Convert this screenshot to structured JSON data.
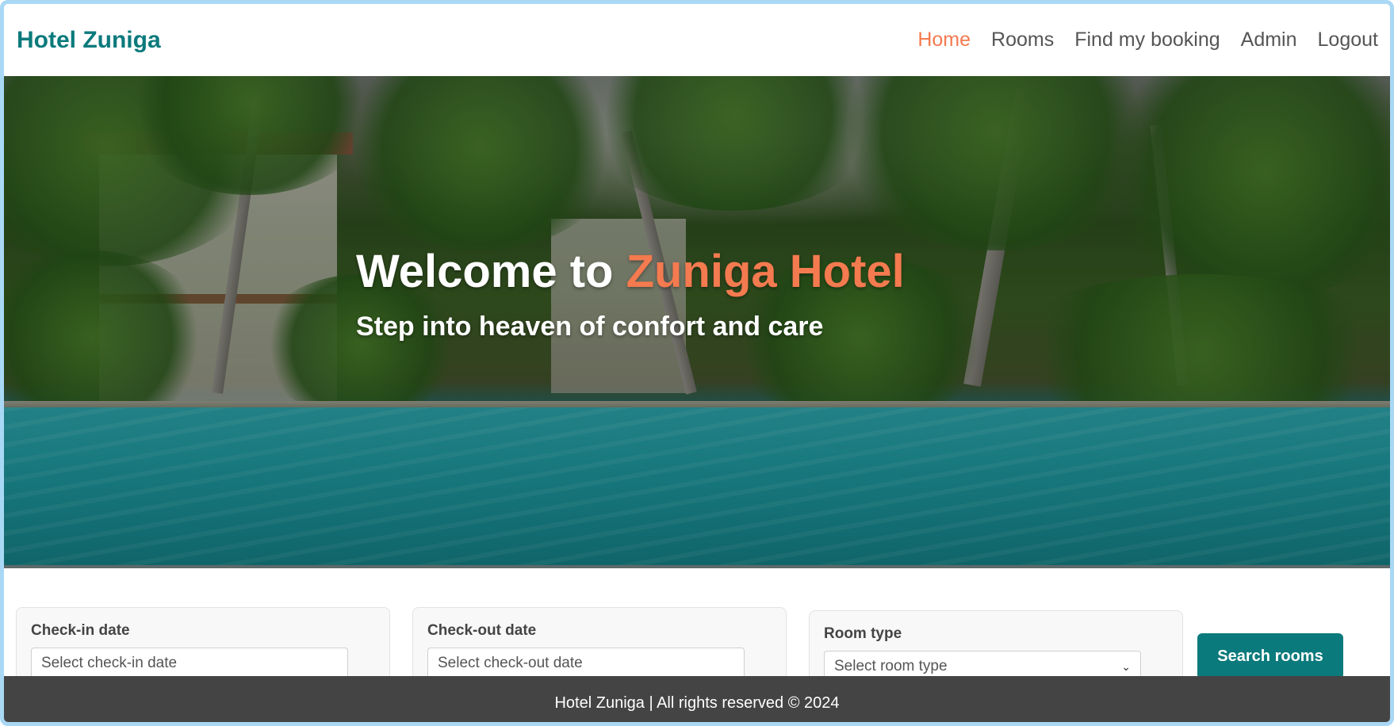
{
  "navbar": {
    "brand": "Hotel Zuniga",
    "links": [
      {
        "label": "Home",
        "active": true
      },
      {
        "label": "Rooms",
        "active": false
      },
      {
        "label": "Find my booking",
        "active": false
      },
      {
        "label": "Admin",
        "active": false
      },
      {
        "label": "Logout",
        "active": false
      }
    ]
  },
  "hero": {
    "title_prefix": "Welcome to ",
    "title_accent": "Zuniga Hotel",
    "subtitle": "Step into heaven of confort and care"
  },
  "search": {
    "checkin": {
      "label": "Check-in date",
      "placeholder": "Select check-in date"
    },
    "checkout": {
      "label": "Check-out date",
      "placeholder": "Select check-out date"
    },
    "room_type": {
      "label": "Room type",
      "placeholder": "Select room type"
    },
    "button": "Search rooms"
  },
  "footer": {
    "text": "Hotel Zuniga | All rights reserved © 2024"
  },
  "colors": {
    "brand": "#0b7a7c",
    "accent": "#f47a4f",
    "footer_bg": "#444444",
    "frame_border": "#a9d8f5"
  }
}
